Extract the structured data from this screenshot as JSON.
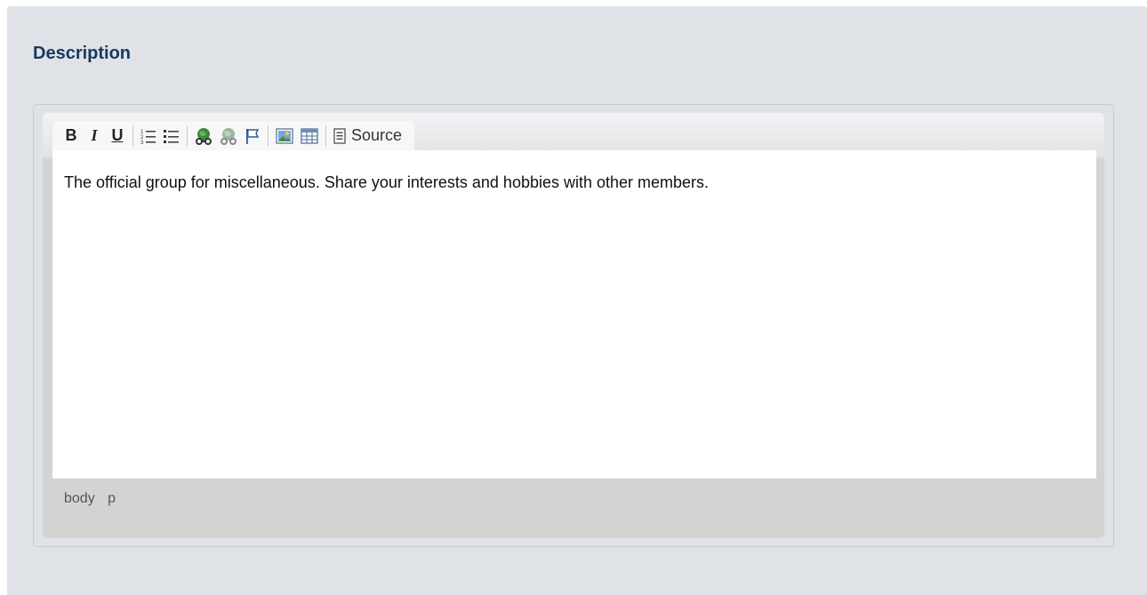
{
  "section": {
    "title": "Description"
  },
  "toolbar": {
    "bold": "B",
    "italic": "I",
    "underline": "U",
    "numbered_list_icon": "numbered-list-icon",
    "bulleted_list_icon": "bulleted-list-icon",
    "link_icon": "link-icon",
    "unlink_icon": "unlink-icon",
    "anchor_icon": "anchor-flag-icon",
    "image_icon": "image-icon",
    "table_icon": "table-icon",
    "source_icon": "source-document-icon",
    "source_label": "Source"
  },
  "editor": {
    "content": "The official group for miscellaneous. Share your interests and hobbies with other members."
  },
  "path_bar": {
    "items": [
      "body",
      "p"
    ]
  },
  "colors": {
    "panel_background": "#dfe2e7",
    "title": "#173a5e",
    "editor_background": "#ffffff",
    "path_bar_background": "#d3d3d3"
  }
}
